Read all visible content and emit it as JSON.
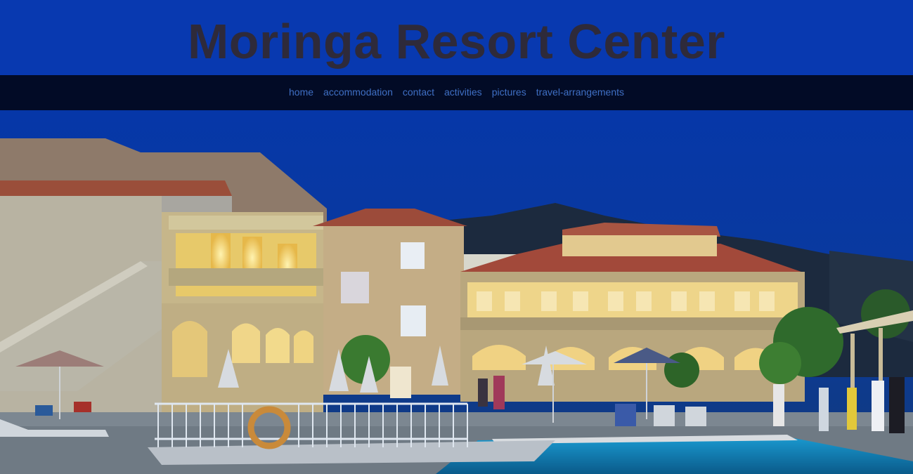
{
  "site": {
    "title": "Moringa Resort Center"
  },
  "nav": {
    "items": [
      {
        "label": "home"
      },
      {
        "label": "accommodation"
      },
      {
        "label": "contact"
      },
      {
        "label": "activities"
      },
      {
        "label": "pictures"
      },
      {
        "label": "travel-arrangements"
      }
    ]
  },
  "hero": {
    "alt": "Resort hotel at dusk with pool"
  },
  "colors": {
    "header_bg": "#0839b0",
    "title": "#2e2a3a",
    "nav_bg": "#020b26",
    "nav_link": "#3f6fc4"
  }
}
